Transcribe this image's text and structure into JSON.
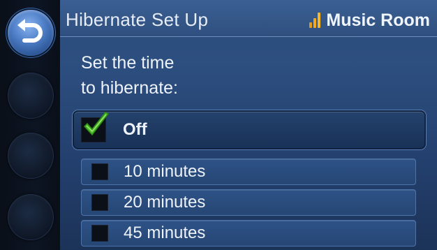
{
  "header": {
    "title": "Hibernate Set Up",
    "zone": "Music Room",
    "signal_colors": [
      "#f0a020",
      "#f0a020",
      "#f0b020"
    ]
  },
  "prompt": {
    "line1": "Set the time",
    "line2": "to hibernate:"
  },
  "options": [
    {
      "label": "Off",
      "checked": true
    },
    {
      "label": "10 minutes",
      "checked": false
    },
    {
      "label": "20 minutes",
      "checked": false
    },
    {
      "label": "45 minutes",
      "checked": false
    }
  ],
  "rail": {
    "back_icon": "back-arrow-icon",
    "soft_buttons": 3
  },
  "colors": {
    "accent": "#2d4f80",
    "check": "#4cbf2a",
    "signal": "#f0a020"
  }
}
